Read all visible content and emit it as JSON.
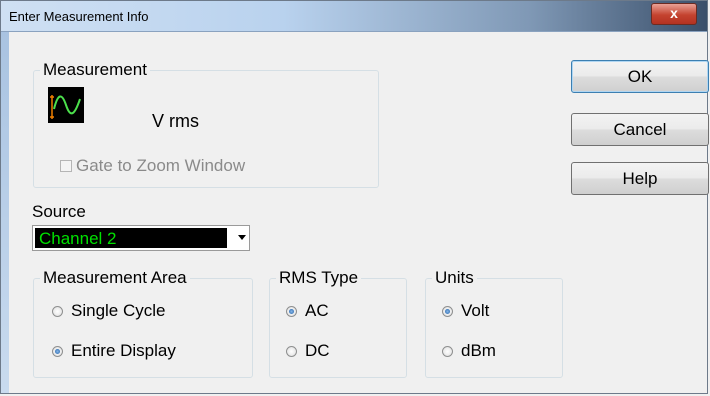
{
  "window": {
    "title": "Enter Measurement Info",
    "close_label": "x"
  },
  "measurement": {
    "group_label": "Measurement",
    "icon": "waveform-icon",
    "name": "V rms",
    "gate_label": "Gate to Zoom Window",
    "gate_checked": false
  },
  "buttons": {
    "ok": "OK",
    "cancel": "Cancel",
    "help": "Help"
  },
  "source": {
    "label": "Source",
    "selected": "Channel 2",
    "text_color": "#00e000",
    "bg_color": "#000000"
  },
  "measurement_area": {
    "label": "Measurement Area",
    "options": [
      {
        "label": "Single Cycle",
        "selected": false
      },
      {
        "label": "Entire Display",
        "selected": true
      }
    ]
  },
  "rms_type": {
    "label": "RMS Type",
    "options": [
      {
        "label": "AC",
        "selected": true
      },
      {
        "label": "DC",
        "selected": false
      }
    ]
  },
  "units": {
    "label": "Units",
    "options": [
      {
        "label": "Volt",
        "selected": true
      },
      {
        "label": "dBm",
        "selected": false
      }
    ]
  }
}
